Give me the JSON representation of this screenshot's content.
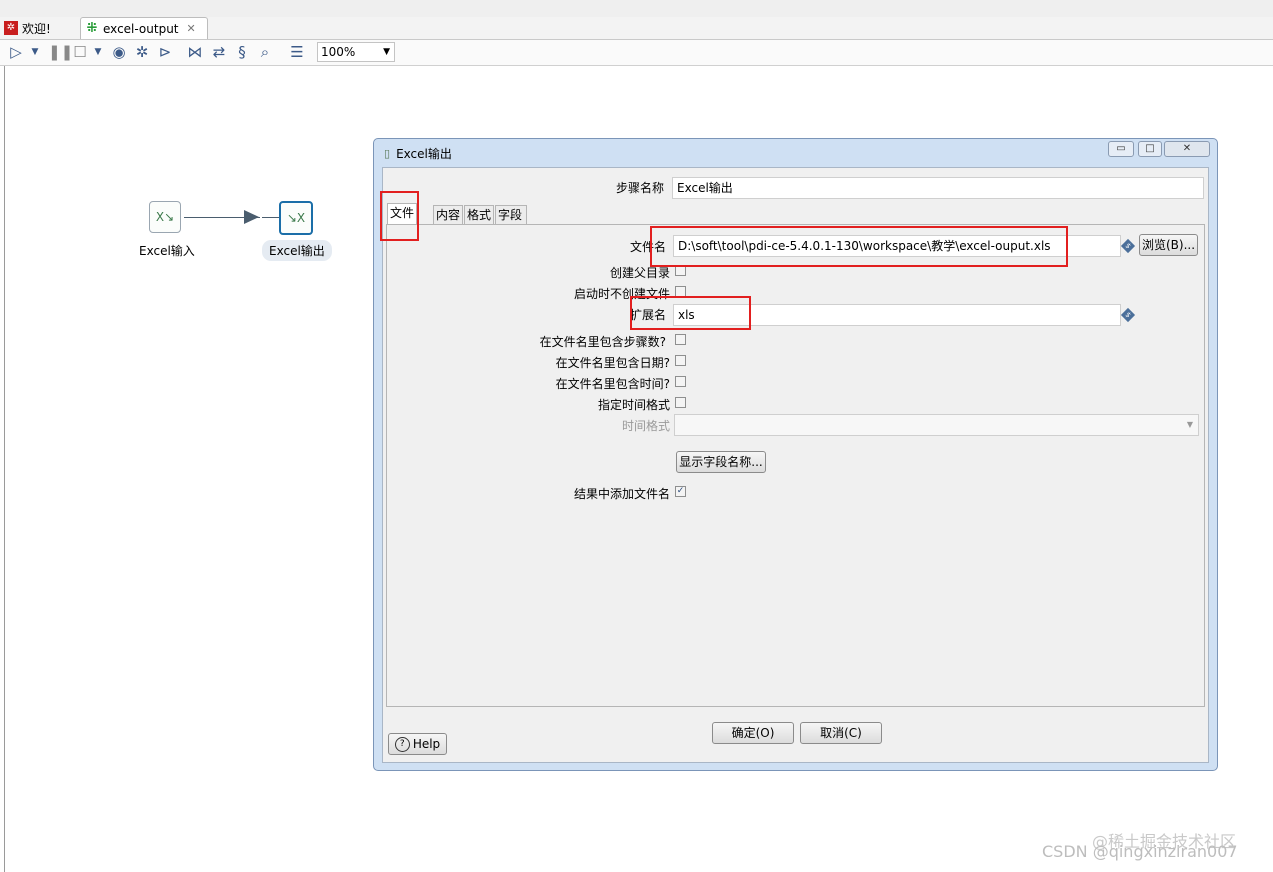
{
  "tabs": [
    {
      "label": "欢迎!",
      "icon": "welcome-icon"
    },
    {
      "label": "excel-output",
      "icon": "transformation-icon"
    }
  ],
  "toolbar": {
    "zoom": "100%"
  },
  "canvas": {
    "steps": [
      {
        "label": "Excel输入",
        "icon": "excel-input-icon"
      },
      {
        "label": "Excel输出",
        "icon": "excel-output-icon"
      }
    ]
  },
  "dialog": {
    "title": "Excel输出",
    "step_name_label": "步骤名称",
    "step_name_value": "Excel输出",
    "tabs": [
      "文件",
      "内容",
      "格式",
      "字段"
    ],
    "filename_label": "文件名",
    "filename_value": "D:\\soft\\tool\\pdi-ce-5.4.0.1-130\\workspace\\教学\\excel-ouput.xls",
    "browse_button": "浏览(B)...",
    "create_parent_label": "创建父目录",
    "no_create_on_start_label": "启动时不创建文件",
    "extension_label": "扩展名",
    "extension_value": "xls",
    "include_stepnr_label": "在文件名里包含步骤数?",
    "include_date_label": "在文件名里包含日期?",
    "include_time_label": "在文件名里包含时间?",
    "specify_format_label": "指定时间格式",
    "time_format_label": "时间格式",
    "show_fields_button": "显示字段名称...",
    "add_to_result_label": "结果中添加文件名",
    "add_to_result_checked": true,
    "ok_button": "确定(O)",
    "cancel_button": "取消(C)",
    "help_button": "Help"
  },
  "watermark": {
    "line1": "@稀土掘金技术社区",
    "line2": "CSDN @qingxinziran007"
  }
}
